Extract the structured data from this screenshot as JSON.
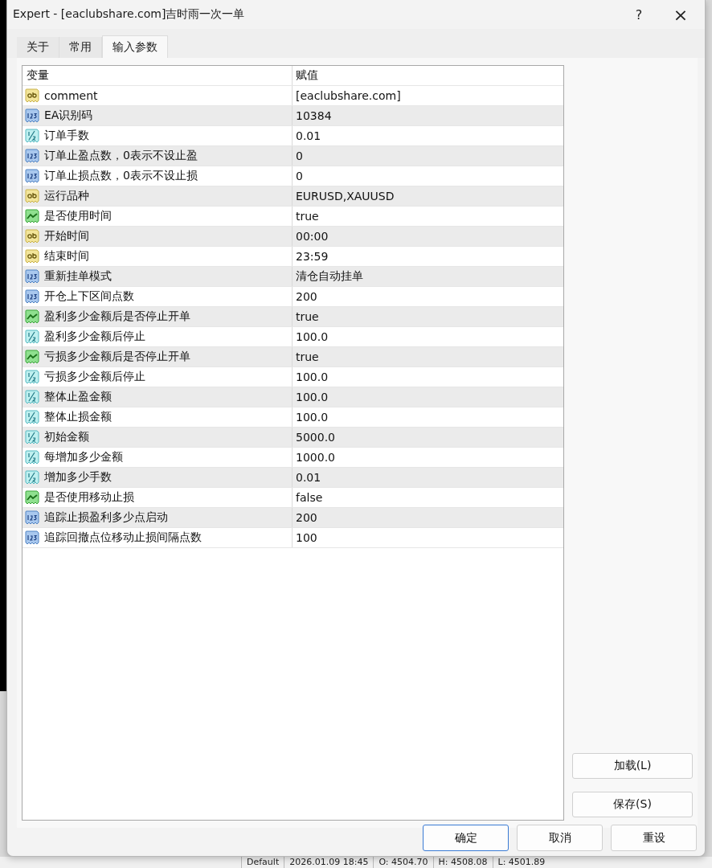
{
  "window": {
    "title": "Expert - [eaclubshare.com]吉时雨一次一单",
    "help": "?",
    "close": "×"
  },
  "tabs": [
    {
      "label": "关于",
      "selected": false
    },
    {
      "label": "常用",
      "selected": false
    },
    {
      "label": "输入参数",
      "selected": true
    }
  ],
  "table": {
    "columns": [
      "变量",
      "赋值"
    ],
    "rows": [
      {
        "kind": "string",
        "name": "comment",
        "value": "[eaclubshare.com]"
      },
      {
        "kind": "int",
        "name": "EA识别码",
        "value": "10384"
      },
      {
        "kind": "double",
        "name": "订单手数",
        "value": "0.01"
      },
      {
        "kind": "int",
        "name": "订单止盈点数，0表示不设止盈",
        "value": "0"
      },
      {
        "kind": "int",
        "name": "订单止损点数，0表示不设止损",
        "value": "0"
      },
      {
        "kind": "string",
        "name": "运行品种",
        "value": "EURUSD,XAUUSD"
      },
      {
        "kind": "bool",
        "name": "是否使用时间",
        "value": "true"
      },
      {
        "kind": "string",
        "name": "开始时间",
        "value": "00:00"
      },
      {
        "kind": "string",
        "name": "结束时间",
        "value": "23:59"
      },
      {
        "kind": "int",
        "name": "重新挂单模式",
        "value": "清仓自动挂单"
      },
      {
        "kind": "int",
        "name": "开仓上下区间点数",
        "value": "200"
      },
      {
        "kind": "bool",
        "name": "盈利多少金额后是否停止开单",
        "value": "true"
      },
      {
        "kind": "double",
        "name": "盈利多少金额后停止",
        "value": "100.0"
      },
      {
        "kind": "bool",
        "name": "亏损多少金额后是否停止开单",
        "value": "true"
      },
      {
        "kind": "double",
        "name": "亏损多少金额后停止",
        "value": "100.0"
      },
      {
        "kind": "double",
        "name": "整体止盈金额",
        "value": "100.0"
      },
      {
        "kind": "double",
        "name": "整体止损金额",
        "value": "100.0"
      },
      {
        "kind": "double",
        "name": "初始金额",
        "value": "5000.0"
      },
      {
        "kind": "double",
        "name": "每增加多少金额",
        "value": "1000.0"
      },
      {
        "kind": "double",
        "name": "增加多少手数",
        "value": "0.01"
      },
      {
        "kind": "bool",
        "name": "是否使用移动止损",
        "value": "false"
      },
      {
        "kind": "int",
        "name": "追踪止损盈利多少点启动",
        "value": "200"
      },
      {
        "kind": "int",
        "name": "追踪回撤点位移动止损间隔点数",
        "value": "100"
      }
    ]
  },
  "side_buttons": [
    "加载(L)",
    "保存(S)"
  ],
  "buttons": [
    {
      "label": "确定",
      "default": true
    },
    {
      "label": "取消",
      "default": false
    },
    {
      "label": "重设",
      "default": false
    }
  ],
  "status_bar": [
    "Default",
    "2026.01.09 18:45",
    "O: 4504.70",
    "H: 4508.08",
    "L: 4501.89"
  ]
}
